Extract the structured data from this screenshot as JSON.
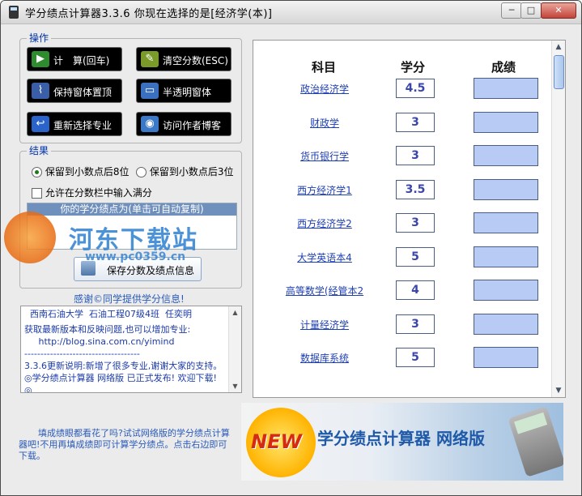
{
  "window": {
    "title": "学分绩点计算器3.3.6   你现在选择的是[经济学(本)]",
    "controls": {
      "minimize": "─",
      "maximize": "□",
      "close": "✕"
    }
  },
  "operations": {
    "group_label": "操作",
    "buttons": [
      {
        "label": "计　算(回车)",
        "icon": "play-icon",
        "glyph": "▶",
        "color": "#2e8b2e"
      },
      {
        "label": "清空分数(ESC)",
        "icon": "broom-icon",
        "glyph": "✎",
        "color": "#7a9a2a"
      },
      {
        "label": "保持窗体置顶",
        "icon": "paperclip-icon",
        "glyph": "📎",
        "color": "#3a5fa8"
      },
      {
        "label": "半透明窗体",
        "icon": "window-icon",
        "glyph": "▭",
        "color": "#3b6fc0"
      },
      {
        "label": "重新选择专业",
        "icon": "back-arrow-icon",
        "glyph": "↩",
        "color": "#2a63c9"
      },
      {
        "label": "访问作者博客",
        "icon": "globe-icon",
        "glyph": "◉",
        "color": "#3c78c8"
      }
    ]
  },
  "result": {
    "group_label": "结果",
    "radio_8": "保留到小数点后8位",
    "radio_3": "保留到小数点后3位",
    "allow_full_label": "允许在分数栏中输入满分",
    "gpa_header": "你的学分绩点为(单击可自动复制)",
    "gpa_value": "",
    "save_button": "保存分数及绩点信息"
  },
  "thanks_text": "感谢©同学提供学分信息!",
  "info_lines": [
    "  西南石油大学  石油工程07级4班  任奕明",
    "",
    "获取最新版本和反映问题,也可以增加专业:",
    "     http://blog.sina.com.cn/yimind",
    "------------------------------------",
    "3.3.6更新说明:新增了很多专业,谢谢大家的支持。  ◎学分绩点计算器 网络版 已正式发布! 欢迎下载! ◎"
  ],
  "tip_text": "填成绩眼都看花了吗?试试网络版的学分绩点计算器吧!不用再填成绩即可计算学分绩点。点击右边即可下载。",
  "table": {
    "headers": {
      "subject": "科目",
      "credit": "学分",
      "score": "成绩"
    },
    "rows": [
      {
        "subject": "政治经济学",
        "credit": "4.5",
        "score": ""
      },
      {
        "subject": "财政学",
        "credit": "3",
        "score": ""
      },
      {
        "subject": "货币银行学",
        "credit": "3",
        "score": ""
      },
      {
        "subject": "西方经济学1",
        "credit": "3.5",
        "score": ""
      },
      {
        "subject": "西方经济学2",
        "credit": "3",
        "score": ""
      },
      {
        "subject": "大学英语本4",
        "credit": "5",
        "score": ""
      },
      {
        "subject": "高等数学(经管本2",
        "credit": "4",
        "score": ""
      },
      {
        "subject": "计量经济学",
        "credit": "3",
        "score": ""
      },
      {
        "subject": "数据库系统",
        "credit": "5",
        "score": ""
      }
    ]
  },
  "banner": {
    "badge": "NEW",
    "title": "学分绩点计算器  网络版"
  },
  "watermark": {
    "text": "河东下载站",
    "url": "www.pc0359.cn"
  },
  "colors": {
    "accent": "#1e3fb3",
    "score_fill": "#b8cbf5",
    "group_label": "#0033aa"
  }
}
